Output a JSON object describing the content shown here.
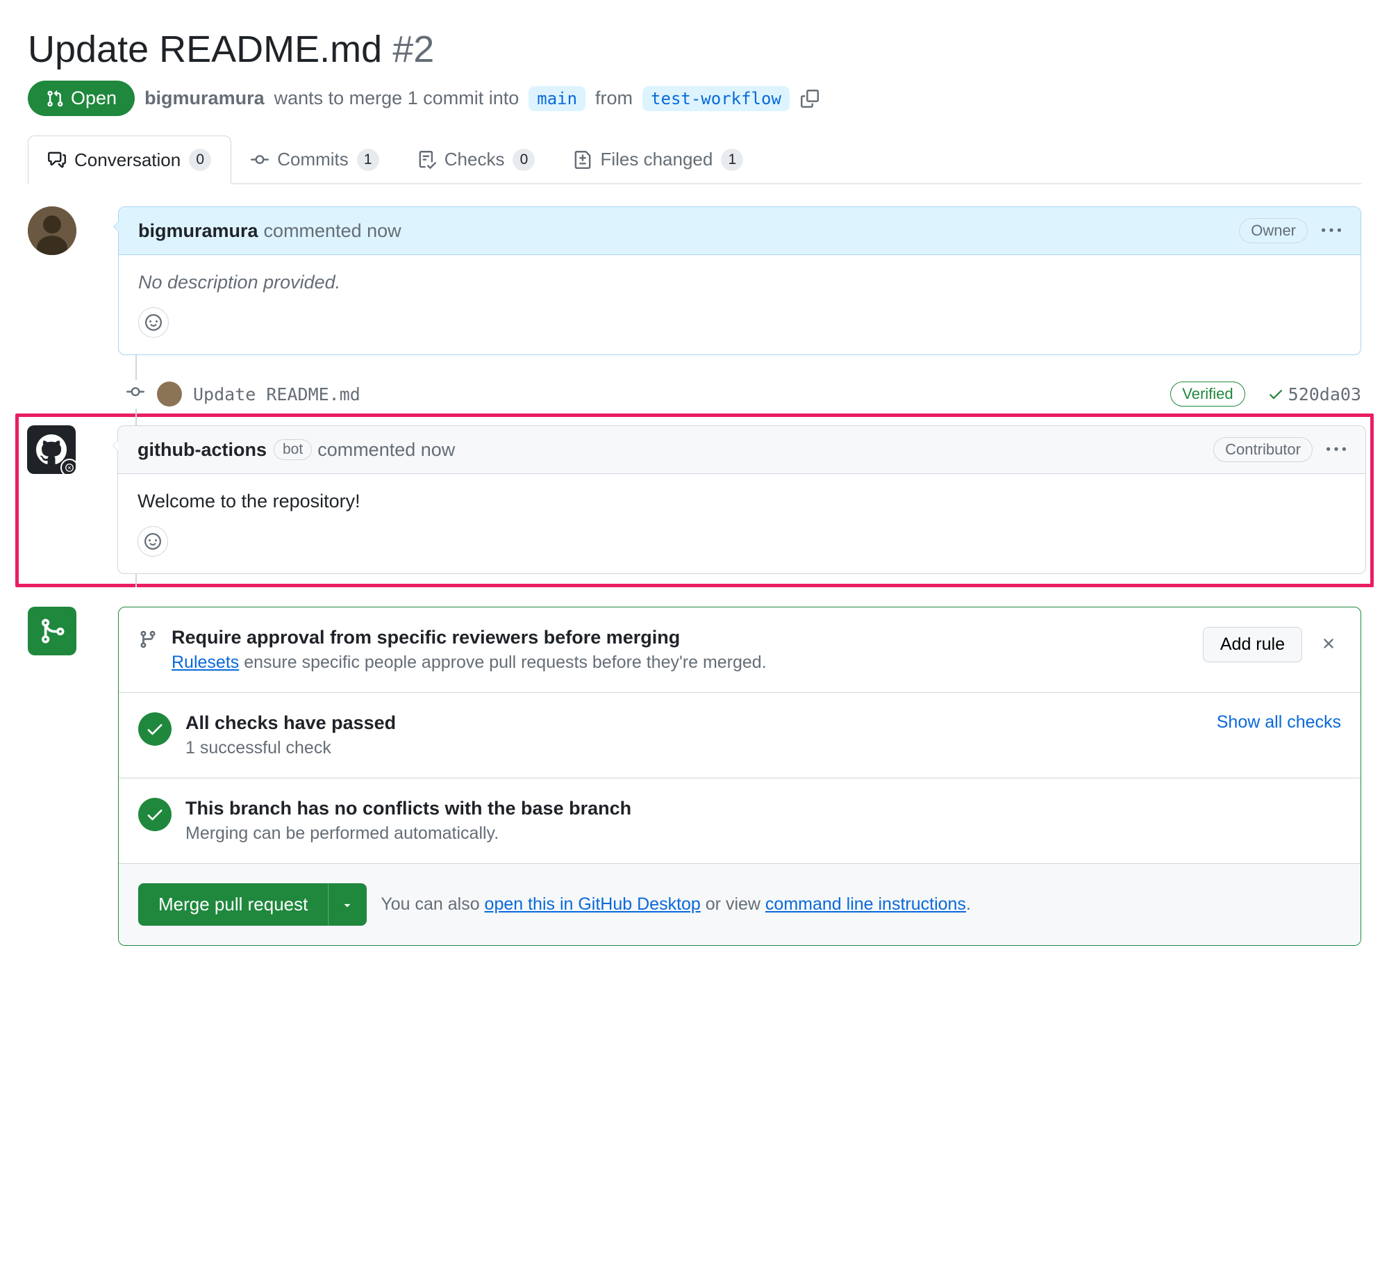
{
  "title": "Update README.md",
  "pr_number": "#2",
  "state": "Open",
  "author": "bigmuramura",
  "merge_info": {
    "text1": "wants to merge 1 commit into",
    "base": "main",
    "text2": "from",
    "head": "test-workflow"
  },
  "tabs": {
    "conversation": {
      "label": "Conversation",
      "count": "0"
    },
    "commits": {
      "label": "Commits",
      "count": "1"
    },
    "checks": {
      "label": "Checks",
      "count": "0"
    },
    "files": {
      "label": "Files changed",
      "count": "1"
    }
  },
  "comment1": {
    "author": "bigmuramura",
    "meta": "commented now",
    "role": "Owner",
    "body": "No description provided."
  },
  "commit": {
    "message": "Update README.md",
    "verified": "Verified",
    "sha": "520da03"
  },
  "comment2": {
    "author": "github-actions",
    "bot": "bot",
    "meta": "commented now",
    "role": "Contributor",
    "body": "Welcome to the repository!"
  },
  "merge": {
    "rule_title": "Require approval from specific reviewers before merging",
    "rule_link": "Rulesets",
    "rule_desc": " ensure specific people approve pull requests before they're merged.",
    "add_rule": "Add rule",
    "checks_title": "All checks have passed",
    "checks_desc": "1 successful check",
    "show_all": "Show all checks",
    "conflicts_title": "This branch has no conflicts with the base branch",
    "conflicts_desc": "Merging can be performed automatically.",
    "merge_btn": "Merge pull request",
    "footer_text1": "You can also ",
    "footer_link1": "open this in GitHub Desktop",
    "footer_text2": " or view ",
    "footer_link2": "command line instructions",
    "footer_text3": "."
  }
}
